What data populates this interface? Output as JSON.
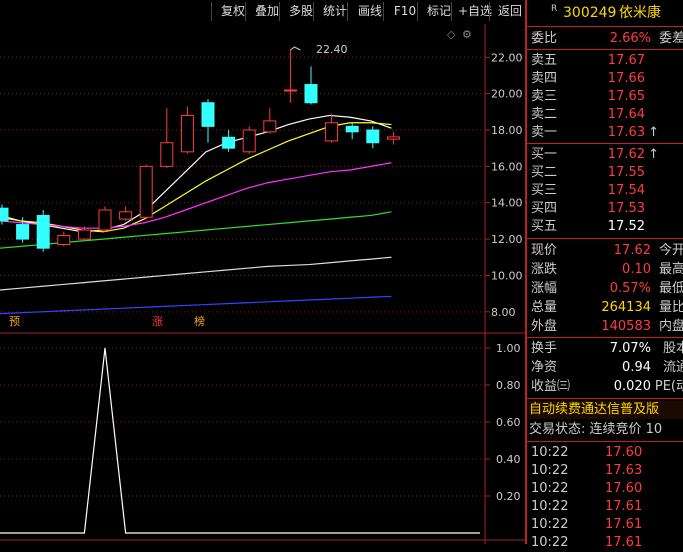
{
  "toolbar": {
    "buttons": [
      "复权",
      "叠加",
      "多股",
      "统计",
      "画线",
      "F10",
      "标记",
      "+自选",
      "返回"
    ]
  },
  "chart": {
    "y_ticks": [
      "22.00",
      "20.00",
      "18.00",
      "16.00",
      "14.00",
      "12.00",
      "10.00",
      "8.00"
    ],
    "peak_label": "22.40",
    "markers": [
      "预",
      "涨",
      "榜"
    ],
    "ind_ticks": [
      "1.00",
      "0.80",
      "0.60",
      "0.40",
      "0.20"
    ]
  },
  "chart_data": {
    "type": "candlestick",
    "ylim": [
      7,
      23.5
    ],
    "candles": [
      {
        "o": 13.7,
        "c": 13.0,
        "h": 13.9,
        "l": 12.8
      },
      {
        "o": 12.8,
        "c": 12.0,
        "h": 13.2,
        "l": 11.8
      },
      {
        "o": 13.3,
        "c": 11.5,
        "h": 13.6,
        "l": 11.3
      },
      {
        "o": 11.7,
        "c": 12.2,
        "h": 12.4,
        "l": 11.6
      },
      {
        "o": 12.0,
        "c": 12.5,
        "h": 12.7,
        "l": 11.9
      },
      {
        "o": 12.5,
        "c": 13.6,
        "h": 13.8,
        "l": 12.4
      },
      {
        "o": 13.1,
        "c": 13.5,
        "h": 13.8,
        "l": 13.0
      },
      {
        "o": 13.2,
        "c": 16.0,
        "h": 16.1,
        "l": 13.1
      },
      {
        "o": 16.0,
        "c": 17.3,
        "h": 19.2,
        "l": 15.9
      },
      {
        "o": 16.8,
        "c": 18.8,
        "h": 19.3,
        "l": 16.7
      },
      {
        "o": 19.5,
        "c": 18.2,
        "h": 19.7,
        "l": 17.3
      },
      {
        "o": 17.6,
        "c": 17.0,
        "h": 18.0,
        "l": 16.8
      },
      {
        "o": 16.8,
        "c": 18.0,
        "h": 18.2,
        "l": 16.7
      },
      {
        "o": 17.9,
        "c": 18.5,
        "h": 19.2,
        "l": 17.8
      },
      {
        "o": 20.2,
        "c": 20.2,
        "h": 22.4,
        "l": 19.5
      },
      {
        "o": 20.5,
        "c": 19.5,
        "h": 21.5,
        "l": 19.4
      },
      {
        "o": 17.4,
        "c": 18.4,
        "h": 18.9,
        "l": 17.3
      },
      {
        "o": 18.2,
        "c": 17.9,
        "h": 18.4,
        "l": 17.5
      },
      {
        "o": 18.0,
        "c": 17.3,
        "h": 18.2,
        "l": 17.0
      },
      {
        "o": 17.5,
        "c": 17.62,
        "h": 17.9,
        "l": 17.2
      }
    ],
    "ma": [
      {
        "color": "#ffffff",
        "values": [
          13.3,
          13.0,
          12.8,
          12.6,
          12.4,
          12.5,
          12.8,
          13.5,
          14.6,
          15.7,
          16.8,
          17.3,
          17.6,
          17.9,
          18.3,
          18.6,
          18.8,
          18.7,
          18.5,
          18.1
        ]
      },
      {
        "color": "#ffff33",
        "values": [
          13.2,
          13.0,
          12.9,
          12.7,
          12.5,
          12.4,
          12.6,
          13.1,
          13.8,
          14.5,
          15.2,
          15.8,
          16.4,
          16.9,
          17.4,
          17.8,
          18.2,
          18.4,
          18.4,
          18.3
        ]
      },
      {
        "color": "#ff33ff",
        "values": [
          13.0,
          12.9,
          12.8,
          12.7,
          12.6,
          12.6,
          12.7,
          12.9,
          13.2,
          13.6,
          14.0,
          14.4,
          14.8,
          15.1,
          15.3,
          15.5,
          15.7,
          15.8,
          16.0,
          16.2
        ]
      },
      {
        "color": "#33dd33",
        "values": [
          11.5,
          11.6,
          11.7,
          11.8,
          11.9,
          12.0,
          12.1,
          12.2,
          12.3,
          12.4,
          12.5,
          12.6,
          12.7,
          12.8,
          12.9,
          13.0,
          13.1,
          13.2,
          13.3,
          13.5
        ]
      },
      {
        "color": "#dddddd",
        "values": [
          9.2,
          9.3,
          9.4,
          9.5,
          9.6,
          9.7,
          9.8,
          9.9,
          10.0,
          10.1,
          10.2,
          10.3,
          10.4,
          10.5,
          10.55,
          10.6,
          10.7,
          10.8,
          10.9,
          11.0
        ]
      },
      {
        "color": "#3344ff",
        "values": [
          7.9,
          7.95,
          8.0,
          8.05,
          8.1,
          8.15,
          8.2,
          8.25,
          8.3,
          8.35,
          8.4,
          8.45,
          8.5,
          8.55,
          8.6,
          8.65,
          8.7,
          8.75,
          8.8,
          8.85
        ]
      }
    ],
    "indicator": [
      0,
      0,
      0,
      0,
      0,
      1,
      0,
      0,
      0,
      0,
      0,
      0,
      0,
      0,
      0,
      0,
      0,
      0,
      0,
      0
    ]
  },
  "quote": {
    "code_prefix": "R",
    "code": "300249",
    "name": "依米康",
    "wei_bi_label": "委比",
    "wei_bi": "2.66%",
    "wei_cha_label": "委差",
    "asks": [
      {
        "label": "卖五",
        "price": "17.67"
      },
      {
        "label": "卖四",
        "price": "17.66"
      },
      {
        "label": "卖三",
        "price": "17.65"
      },
      {
        "label": "卖二",
        "price": "17.64"
      },
      {
        "label": "卖一",
        "price": "17.63",
        "arrow": "↑"
      }
    ],
    "bids": [
      {
        "label": "买一",
        "price": "17.62",
        "arrow": "↑"
      },
      {
        "label": "买二",
        "price": "17.55"
      },
      {
        "label": "买三",
        "price": "17.54"
      },
      {
        "label": "买四",
        "price": "17.53"
      },
      {
        "label": "买五",
        "price": "17.52"
      }
    ],
    "stats1": [
      {
        "k": "现价",
        "v": "17.62",
        "r": "今开",
        "cls": "red"
      },
      {
        "k": "涨跌",
        "v": "0.10",
        "r": "最高",
        "cls": "red"
      },
      {
        "k": "涨幅",
        "v": "0.57%",
        "r": "最低",
        "cls": "red"
      },
      {
        "k": "总量",
        "v": "264134",
        "r": "量比",
        "cls": "yel"
      },
      {
        "k": "外盘",
        "v": "140583",
        "r": "内盘",
        "cls": "red"
      }
    ],
    "stats2": [
      {
        "k": "换手",
        "v": "7.07%",
        "r": "股本",
        "cls": "wht"
      },
      {
        "k": "净资",
        "v": "0.94",
        "r": "流通",
        "cls": "wht"
      },
      {
        "k": "收益㈢",
        "v": "0.020",
        "r": "PE(动",
        "cls": "wht"
      }
    ],
    "ad_text": "自动续费通达信普及版",
    "trade_status": "交易状态: 连续竞价 10",
    "ticks": [
      {
        "t": "10:22",
        "p": "17.60"
      },
      {
        "t": "10:22",
        "p": "17.63"
      },
      {
        "t": "10:22",
        "p": "17.60"
      },
      {
        "t": "10:22",
        "p": "17.61"
      },
      {
        "t": "10:22",
        "p": "17.61"
      },
      {
        "t": "10:22",
        "p": "17.61"
      }
    ]
  }
}
